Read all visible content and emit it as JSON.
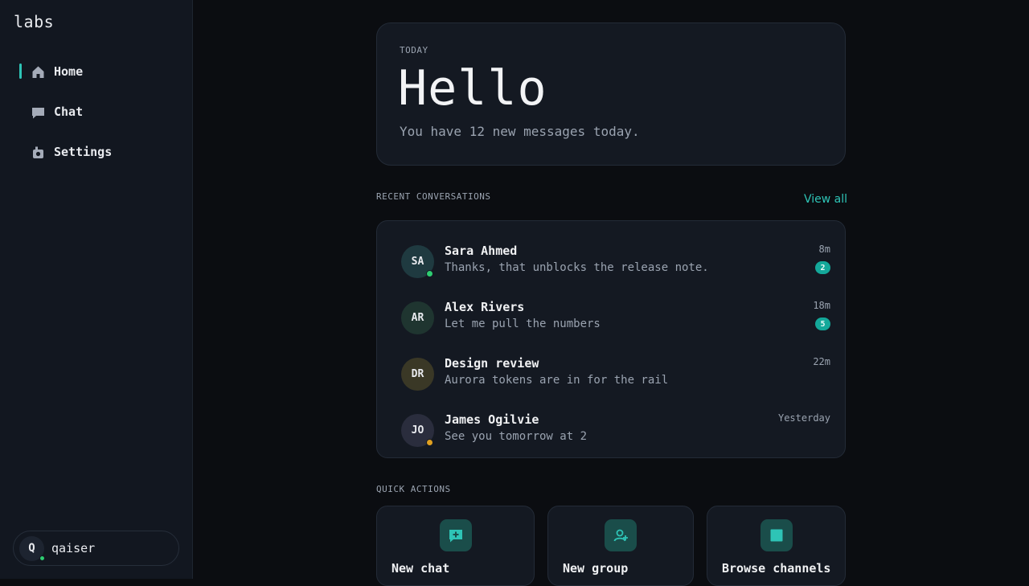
{
  "sidebar": {
    "brand": "labs",
    "items": [
      {
        "label": "Home",
        "icon": "home-icon",
        "active": true
      },
      {
        "label": "Chat",
        "icon": "chat-icon",
        "active": false
      },
      {
        "label": "Settings",
        "icon": "gear-icon",
        "active": false
      }
    ],
    "user": {
      "initial": "Q",
      "name": "qaiser",
      "status_color": "#2ecc71"
    }
  },
  "hero": {
    "kicker": "TODAY",
    "title": "Hello",
    "subtitle": "You have 12 new messages today."
  },
  "recent": {
    "label": "RECENT CONVERSATIONS",
    "view_all": "View all",
    "conversations": [
      {
        "initials": "SA",
        "name": "Sara Ahmed",
        "preview": "Thanks, that unblocks the release note.",
        "time": "8m",
        "badge": "2",
        "avatar_color": "#1f3a40",
        "status_color": "#2ecc71"
      },
      {
        "initials": "AR",
        "name": "Alex Rivers",
        "preview": "Let me pull the numbers",
        "time": "18m",
        "badge": "5",
        "avatar_color": "#1f3530",
        "status_color": ""
      },
      {
        "initials": "DR",
        "name": "Design review",
        "preview": "Aurora tokens are in for the rail",
        "time": "22m",
        "badge": "",
        "avatar_color": "#3a3826",
        "status_color": ""
      },
      {
        "initials": "JO",
        "name": "James Ogilvie",
        "preview": "See you tomorrow at 2",
        "time": "Yesterday",
        "badge": "",
        "avatar_color": "#2a2d3d",
        "status_color": "#e0a020"
      }
    ]
  },
  "quick_actions": {
    "label": "QUICK ACTIONS",
    "items": [
      {
        "label": "New chat",
        "icon": "chat-plus-icon"
      },
      {
        "label": "New group",
        "icon": "group-add-icon"
      },
      {
        "label": "Browse channels",
        "icon": "channels-icon"
      }
    ]
  },
  "colors": {
    "accent": "#2ec4b6",
    "badge": "#14a89a",
    "background": "#0b0d11",
    "sidebar": "#121720"
  }
}
